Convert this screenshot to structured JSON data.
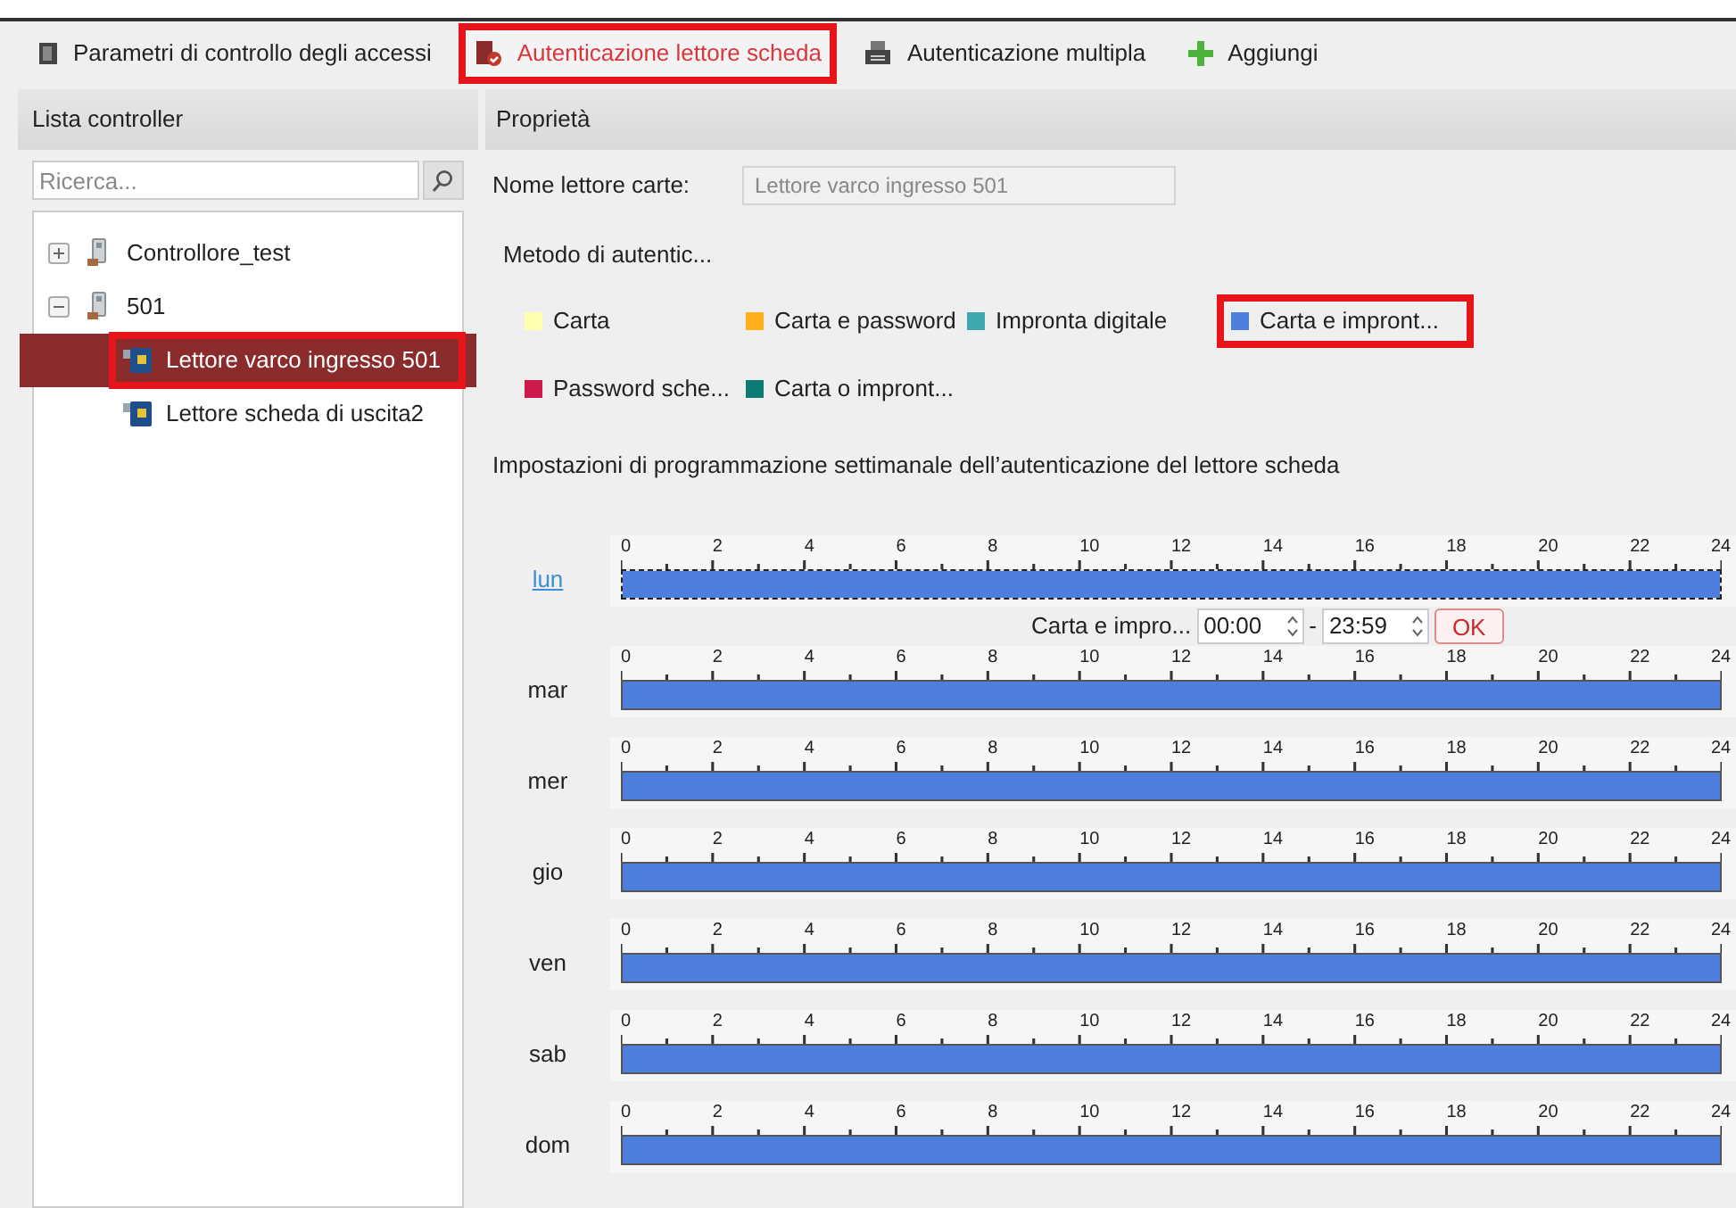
{
  "toolbar": {
    "tabs": [
      {
        "label": "Parametri di controllo degli accessi",
        "selected": false,
        "highlighted": false
      },
      {
        "label": "Autenticazione lettore scheda",
        "selected": true,
        "highlighted": true
      },
      {
        "label": "Autenticazione multipla",
        "selected": false,
        "highlighted": false
      },
      {
        "label": "Aggiungi",
        "selected": false,
        "highlighted": false
      }
    ]
  },
  "left_panel": {
    "title": "Lista controller",
    "search": {
      "placeholder": "Ricerca..."
    },
    "tree": [
      {
        "label": "Controllore_test",
        "expanded": false,
        "selected": false
      },
      {
        "label": "501",
        "expanded": true,
        "selected": false,
        "children": [
          {
            "label": "Lettore varco ingresso 501",
            "selected": true,
            "highlighted": true
          },
          {
            "label": "Lettore scheda di uscita2",
            "selected": false,
            "highlighted": false
          }
        ]
      }
    ]
  },
  "right_panel": {
    "title": "Proprietà",
    "name_field": {
      "label": "Nome lettore carte:",
      "value": "Lettore varco ingresso 501",
      "disabled": true
    },
    "method_label": "Metodo di autentic...",
    "methods": [
      {
        "label": "Carta",
        "color": "#ffffb0",
        "highlighted": false
      },
      {
        "label": "Carta e password",
        "color": "#ffb01a",
        "highlighted": false
      },
      {
        "label": "Impronta digitale",
        "color": "#3eaab0",
        "highlighted": false
      },
      {
        "label": "Carta e impront...",
        "color": "#4f7fdc",
        "highlighted": true
      },
      {
        "label": "Password sche...",
        "color": "#cc1b4a",
        "highlighted": false
      },
      {
        "label": "Carta o impront...",
        "color": "#0b7b73",
        "highlighted": false
      }
    ],
    "schedule_title": "Impostazioni di programmazione settimanale dell’autenticazione del lettore scheda",
    "days": [
      {
        "label": "lun",
        "selected": true,
        "level": 1,
        "ticks": [
          "0",
          "2",
          "4",
          "6",
          "8",
          "10",
          "12",
          "14",
          "16",
          "18",
          "20",
          "22",
          "24"
        ]
      },
      {
        "label": "mar",
        "selected": false,
        "level": 1,
        "ticks": [
          "0",
          "2",
          "4",
          "6",
          "8",
          "10",
          "12",
          "14",
          "16",
          "18",
          "20",
          "22",
          "24"
        ]
      },
      {
        "label": "mer",
        "selected": false,
        "level": 1,
        "ticks": [
          "0",
          "2",
          "4",
          "6",
          "8",
          "10",
          "12",
          "14",
          "16",
          "18",
          "20",
          "22",
          "24"
        ]
      },
      {
        "label": "gio",
        "selected": false,
        "level": 1,
        "ticks": [
          "0",
          "2",
          "4",
          "6",
          "8",
          "10",
          "12",
          "14",
          "16",
          "18",
          "20",
          "22",
          "24"
        ]
      },
      {
        "label": "ven",
        "selected": false,
        "level": 1,
        "ticks": [
          "0",
          "2",
          "4",
          "6",
          "8",
          "10",
          "12",
          "14",
          "16",
          "18",
          "20",
          "22",
          "24"
        ]
      },
      {
        "label": "sab",
        "selected": false,
        "level": 1,
        "ticks": [
          "0",
          "2",
          "4",
          "6",
          "8",
          "10",
          "12",
          "14",
          "16",
          "18",
          "20",
          "22",
          "24"
        ]
      },
      {
        "label": "dom",
        "selected": false,
        "level": 1,
        "ticks": [
          "0",
          "2",
          "4",
          "6",
          "8",
          "10",
          "12",
          "14",
          "16",
          "18",
          "20",
          "22",
          "24"
        ]
      }
    ],
    "time_editor": {
      "label": "Carta e impro...",
      "start": "00:00",
      "separator": "-",
      "end": "23:59",
      "ok": "OK"
    }
  }
}
